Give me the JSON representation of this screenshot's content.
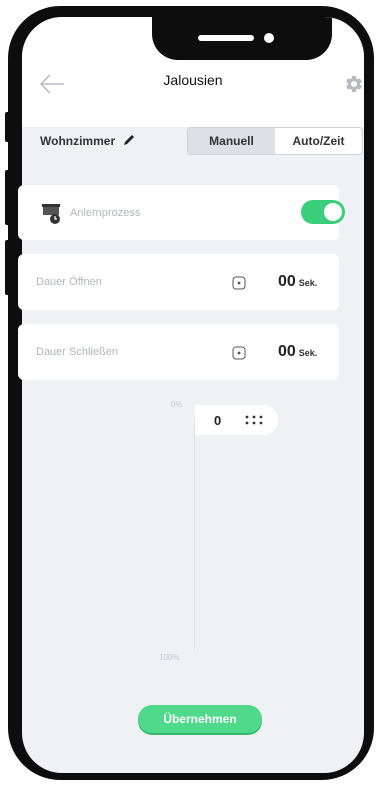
{
  "header": {
    "title": "Jalousien"
  },
  "room": {
    "name": "Wohnzimmer"
  },
  "mode": {
    "manual_label": "Manuell",
    "auto_label": "Auto/Zeit",
    "selected": "Manuell"
  },
  "learning": {
    "label": "Anlernprozess",
    "enabled": true
  },
  "open_duration": {
    "label": "Dauer Öffnen",
    "value": "00",
    "unit": "Sek."
  },
  "close_duration": {
    "label": "Dauer Schließen",
    "value": "00",
    "unit": "Sek."
  },
  "position": {
    "top_label": "0%",
    "bottom_label": "100%",
    "value": "0"
  },
  "actions": {
    "apply_label": "Übernehmen"
  },
  "colors": {
    "accent": "#3ccf7a",
    "background": "#eff1f5"
  }
}
